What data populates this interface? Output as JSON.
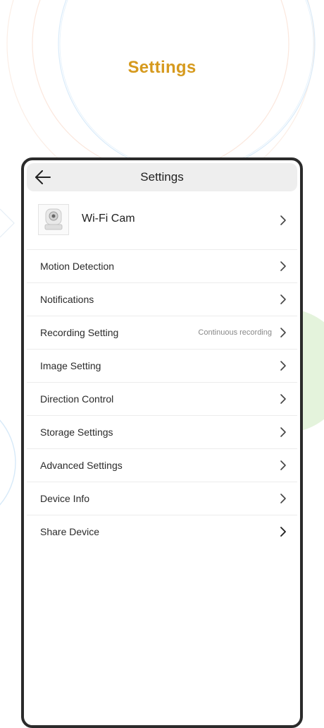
{
  "promo": {
    "title": "Settings",
    "title_color": "#d69a1e"
  },
  "header": {
    "title": "Settings",
    "back_icon": "arrow-left-icon"
  },
  "device": {
    "name": "Wi-Fi Cam",
    "icon": "camera-icon"
  },
  "menu": [
    {
      "label": "Motion Detection",
      "value": ""
    },
    {
      "label": "Notifications",
      "value": ""
    },
    {
      "label": "Recording Setting",
      "value": "Continuous recording"
    },
    {
      "label": "Image Setting",
      "value": ""
    },
    {
      "label": "Direction Control",
      "value": ""
    },
    {
      "label": "Storage Settings",
      "value": ""
    },
    {
      "label": "Advanced Settings",
      "value": ""
    },
    {
      "label": "Device Info",
      "value": ""
    },
    {
      "label": "Share Device",
      "value": ""
    }
  ],
  "colors": {
    "accent": "#d69a1e",
    "header_bg": "#eeeeee",
    "frame": "#2b2b2b",
    "decor_green": "#e4f3dc"
  }
}
